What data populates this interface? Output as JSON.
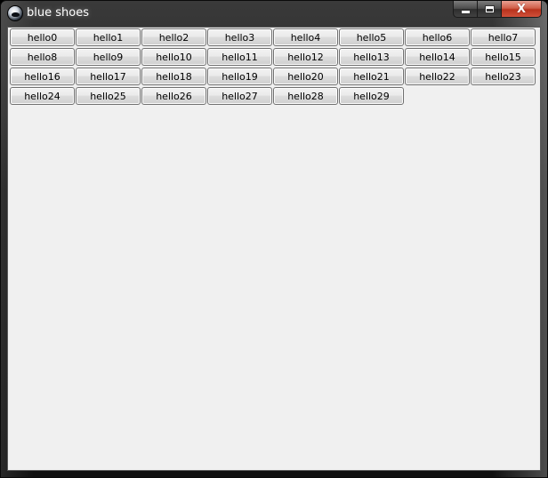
{
  "window": {
    "title": "blue shoes"
  },
  "caption_buttons": {
    "minimize_icon": "minimize-icon",
    "maximize_icon": "maximize-icon",
    "close_icon": "close-icon",
    "close_glyph": "X"
  },
  "buttons": [
    "hello0",
    "hello1",
    "hello2",
    "hello3",
    "hello4",
    "hello5",
    "hello6",
    "hello7",
    "hello8",
    "hello9",
    "hello10",
    "hello11",
    "hello12",
    "hello13",
    "hello14",
    "hello15",
    "hello16",
    "hello17",
    "hello18",
    "hello19",
    "hello20",
    "hello21",
    "hello22",
    "hello23",
    "hello24",
    "hello25",
    "hello26",
    "hello27",
    "hello28",
    "hello29"
  ],
  "colors": {
    "client_background": "#f0f0f0",
    "close_button": "#c7432a"
  }
}
